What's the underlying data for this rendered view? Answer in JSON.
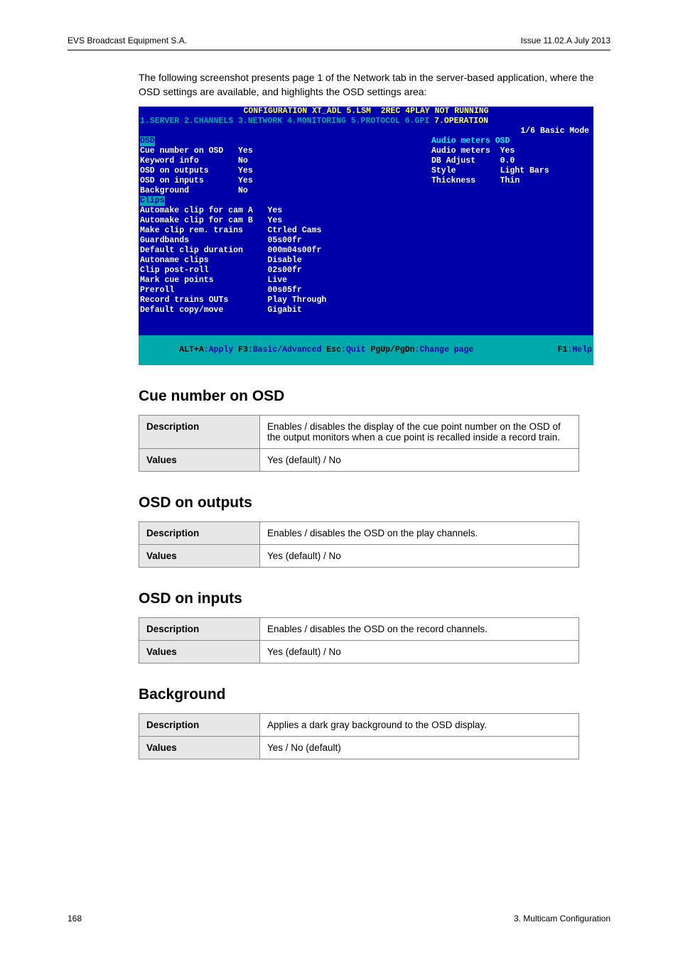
{
  "header": {
    "left": "EVS Broadcast Equipment S.A.",
    "right": "Issue 11.02.A  July 2013"
  },
  "intro": "The following screenshot presents page 1 of the Network tab in the server-based application, where the OSD settings are available, and highlights the OSD settings area:",
  "terminal": {
    "title": "CONFIGURATION XT_ADL 5.LSM  2REC 4PLAY NOT RUNNING",
    "tabs": "1.SERVER 2.CHANNELS 3.NETWORK 4.MONITORING 5.PROTOCOL 6.GPI ",
    "tabs_active": "7.OPERATION",
    "mode": "1/6 Basic Mode",
    "osd_header": "OSD",
    "osd_rows": [
      {
        "label": "Cue number on OSD",
        "value": "Yes"
      },
      {
        "label": "Keyword info",
        "value": "No"
      },
      {
        "label": "OSD on outputs",
        "value": "Yes"
      },
      {
        "label": "OSD on inputs",
        "value": "Yes"
      },
      {
        "label": "Background",
        "value": "No"
      }
    ],
    "audio_header": "Audio meters OSD",
    "audio_rows": [
      {
        "label": "Audio meters",
        "value": "Yes"
      },
      {
        "label": "DB Adjust",
        "value": "0.0"
      },
      {
        "label": "Style",
        "value": "Light Bars"
      },
      {
        "label": "Thickness",
        "value": "Thin"
      }
    ],
    "clips_header": "Clips",
    "clips_rows": [
      {
        "label": "Automake clip for cam A",
        "value": "Yes"
      },
      {
        "label": "Automake clip for cam B",
        "value": "Yes"
      },
      {
        "label": "Make clip rem. trains",
        "value": "Ctrled Cams"
      },
      {
        "label": "Guardbands",
        "value": "05s00fr"
      },
      {
        "label": "Default clip duration",
        "value": "000m04s00fr"
      },
      {
        "label": "Autoname clips",
        "value": "Disable"
      },
      {
        "label": "Clip post-roll",
        "value": "02s00fr"
      },
      {
        "label": "Mark cue points",
        "value": "Live"
      },
      {
        "label": "Preroll",
        "value": "00s05fr"
      },
      {
        "label": "Record trains OUTs",
        "value": "Play Through"
      },
      {
        "label": "Default copy/move",
        "value": "Gigabit"
      }
    ],
    "footer_l_k": "ALT+A",
    "footer_l_v": ":Apply ",
    "footer_l2_k": "F3",
    "footer_l2_v": ":Basic/Advanced ",
    "footer_l3_k": "Esc",
    "footer_l3_v": ":Quit ",
    "footer_l4_k": "PgUp/PgDn",
    "footer_l4_v": ":Change page",
    "footer_r_k": "F1",
    "footer_r_v": ":Help"
  },
  "sections": [
    {
      "title": "Cue number on OSD",
      "desc_label": "Description",
      "desc_value": "Enables / disables the display of the cue point number on the OSD of the output monitors when a cue point is recalled inside a record train.",
      "val_label": "Values",
      "val_value": "Yes (default) / No"
    },
    {
      "title": "OSD on outputs",
      "desc_label": "Description",
      "desc_value": "Enables / disables the OSD on the play channels.",
      "val_label": "Values",
      "val_value": "Yes (default) / No"
    },
    {
      "title": "OSD on inputs",
      "desc_label": "Description",
      "desc_value": "Enables / disables the OSD on the record channels.",
      "val_label": "Values",
      "val_value": "Yes (default) / No"
    },
    {
      "title": "Background",
      "desc_label": "Description",
      "desc_value": "Applies a dark gray background to the OSD display.",
      "val_label": "Values",
      "val_value": "Yes / No (default)"
    }
  ],
  "footer": {
    "left": "168",
    "right": "3. Multicam Configuration"
  }
}
